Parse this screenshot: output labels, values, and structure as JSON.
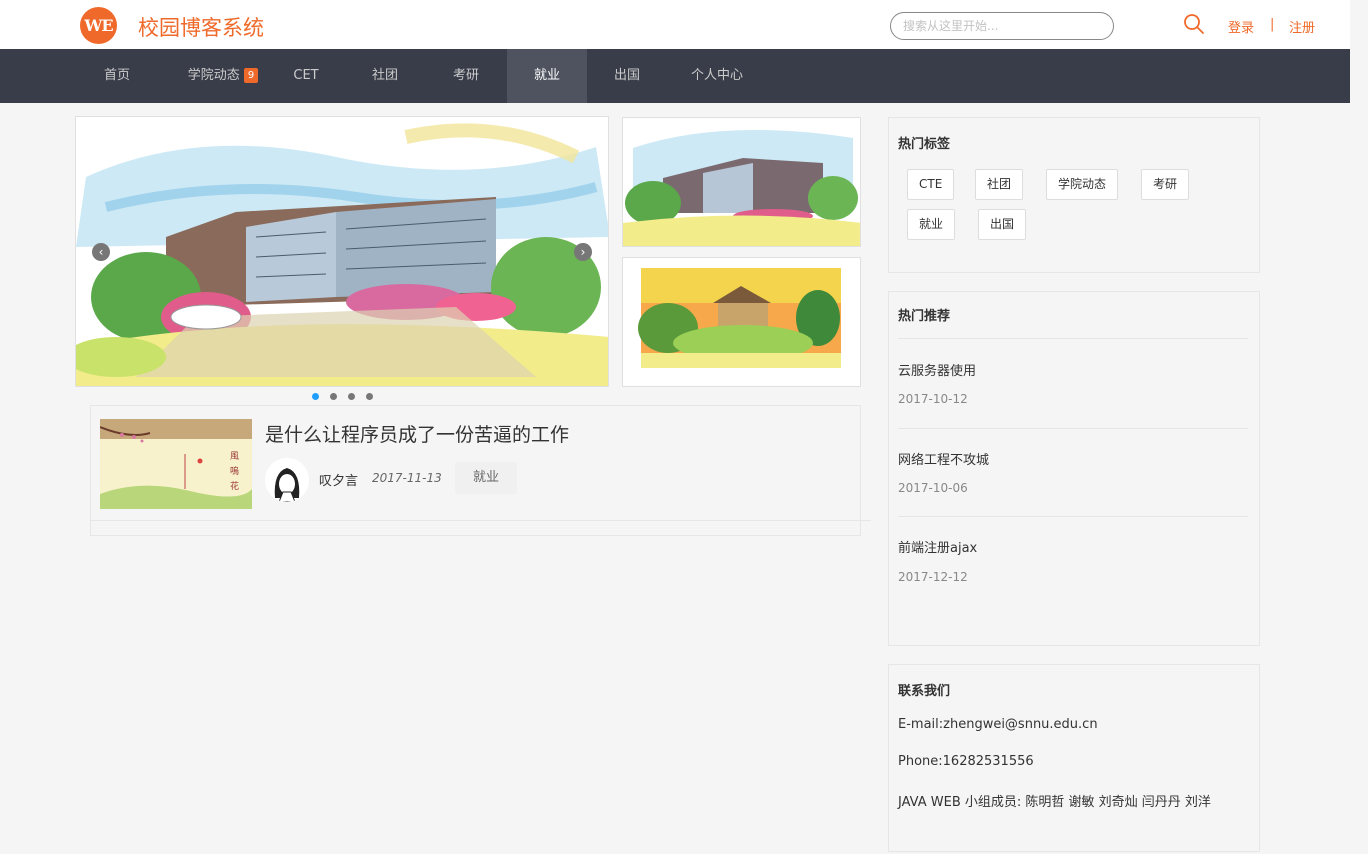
{
  "header": {
    "logo_text": "WE",
    "site_title": "校园博客系统",
    "search_placeholder": "搜索从这里开始...",
    "login": "登录",
    "separator": "|",
    "register": "注册"
  },
  "nav": {
    "items": [
      {
        "label": "首页"
      },
      {
        "label": "学院动态",
        "badge": "9"
      },
      {
        "label": "CET"
      },
      {
        "label": "社团"
      },
      {
        "label": "考研"
      },
      {
        "label": "就业",
        "active": true
      },
      {
        "label": "出国"
      },
      {
        "label": "个人中心"
      }
    ]
  },
  "carousel": {
    "prev_symbol": "‹",
    "next_symbol": "›",
    "dot_count": 4,
    "active_dot": 1
  },
  "article": {
    "title": "是什么让程序员成了一份苦逼的工作",
    "author": "叹夕言",
    "date": "2017-11-13",
    "category": "就业"
  },
  "sidebar": {
    "hot_tags": {
      "title": "热门标签",
      "tags": [
        "CTE",
        "社团",
        "学院动态",
        "考研",
        "就业",
        "出国"
      ]
    },
    "hot_recommend": {
      "title": "热门推荐",
      "items": [
        {
          "title": "云服务器使用",
          "date": "2017-10-12"
        },
        {
          "title": "网络工程不攻城",
          "date": "2017-10-06"
        },
        {
          "title": "前端注册ajax",
          "date": "2017-12-12"
        }
      ]
    },
    "contact": {
      "title": "联系我们",
      "email": "E-mail:zhengwei@snnu.edu.cn",
      "phone": "Phone:16282531556",
      "members": "JAVA WEB 小组成员: 陈明哲 谢敏 刘奇灿 闫丹丹 刘洋"
    }
  }
}
